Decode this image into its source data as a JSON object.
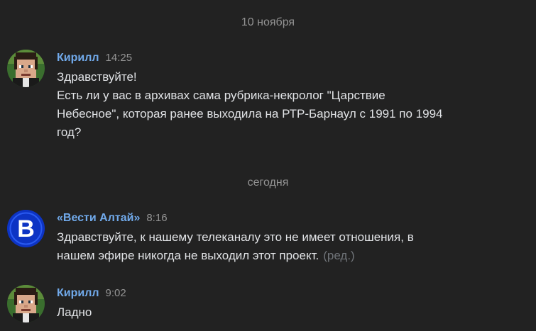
{
  "separators": {
    "first": "10 ноября",
    "second": "сегодня"
  },
  "messages": [
    {
      "author": "Кирилл",
      "time": "14:25",
      "lines": [
        "Здравствуйте!",
        "Есть ли у вас в архивах сама рубрика-некролог \"Царствие",
        "Небесное\", которая ранее выходила на РТР-Барнаул с 1991 по 1994",
        "год?"
      ]
    },
    {
      "author": "«Вести Алтай»",
      "time": "8:16",
      "lines": [
        "Здравствуйте, к нашему телеканалу это не имеет отношения, в",
        "нашем эфире никогда не выходил этот проект."
      ],
      "edited": "(ред.)",
      "avatar_letter": "В"
    },
    {
      "author": "Кирилл",
      "time": "9:02",
      "lines": [
        "Ладно"
      ]
    }
  ],
  "colors": {
    "background": "#222222",
    "author": "#71aaeb",
    "text": "#e1e3e6",
    "muted": "#939393",
    "vesti_blue": "#1144cc"
  }
}
